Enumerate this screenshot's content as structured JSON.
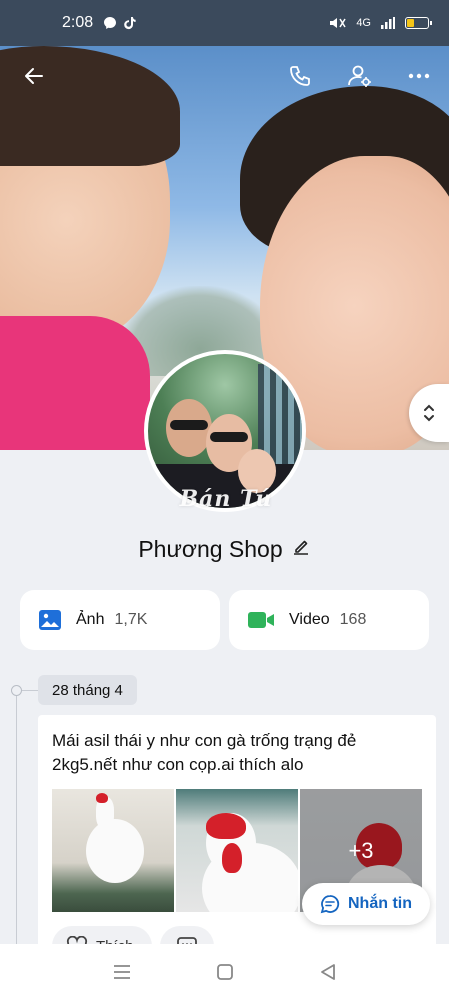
{
  "status_bar": {
    "time": "2:08",
    "network": "4G",
    "battery_level": 0.3,
    "battery_color": "#f5c518"
  },
  "toolbar": {
    "icons": [
      "back-arrow-icon",
      "phone-icon",
      "profile-settings-icon",
      "more-icon"
    ]
  },
  "profile": {
    "name": "Phương Shop",
    "watermark": "Bán Tú"
  },
  "media": {
    "photos_label": "Ảnh",
    "photos_count": "1,7K",
    "videos_label": "Video",
    "videos_count": "168",
    "photos_color": "#1e6fd9",
    "videos_color": "#2fb35a"
  },
  "timeline": {
    "date": "28 tháng 4"
  },
  "post": {
    "text": "Mái asil thái y như con gà trống trạng đẻ 2kg5.nết như con cọp.ai thích alo",
    "more_images": "+3",
    "like_label": "Thích"
  },
  "message_button": {
    "label": "Nhắn tin",
    "color": "#1565c0"
  }
}
